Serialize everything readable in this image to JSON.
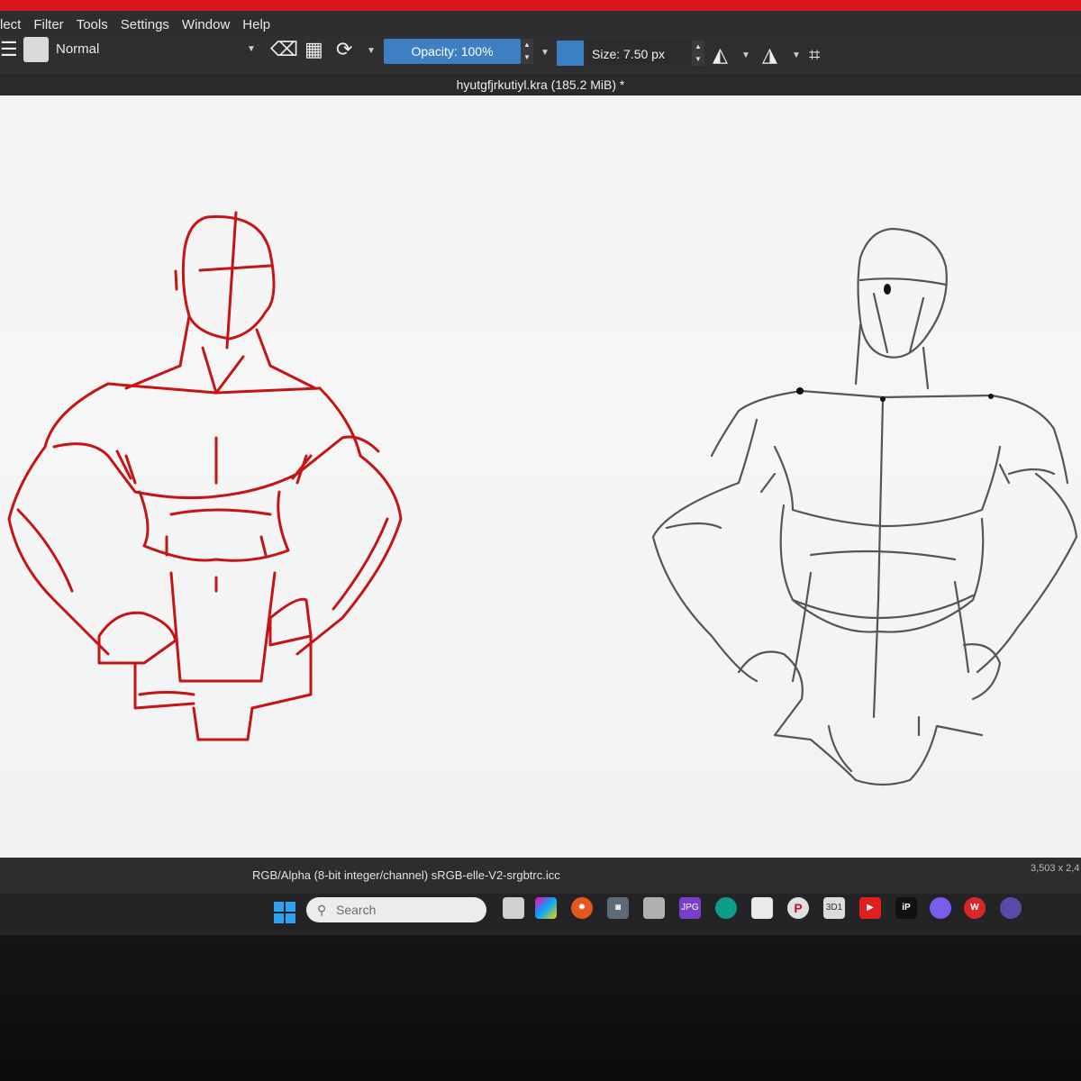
{
  "app": {
    "menu": [
      "lect",
      "Filter",
      "Tools",
      "Settings",
      "Window",
      "Help"
    ],
    "blend_mode": "Normal",
    "opacity_label": "Opacity: 100%",
    "size_label": "Size: 7.50 px",
    "document_title": "hyutgfjrkutiyl.kra (185.2 MiB) *",
    "status": "RGB/Alpha (8-bit integer/channel)  sRGB-elle-V2-srgbtrc.icc",
    "dimensions": "3,503 x 2,4",
    "colors": {
      "accent": "#3d7fc2",
      "red_sketch": "#c41414",
      "gray_sketch": "#3a3a3a"
    }
  },
  "taskbar": {
    "search_placeholder": "Search",
    "icons": [
      "windows-start-icon",
      "search-icon",
      "task-view-icon",
      "copilot-icon",
      "settings-gear-icon",
      "camera-icon",
      "file-explorer-icon",
      "jpg-app-icon",
      "edge-icon",
      "store-icon",
      "pinterest-icon",
      "3d1-app-icon",
      "youtube-icon",
      "ip-app-icon",
      "messenger-icon",
      "wps-icon",
      "krita-icon"
    ],
    "labels": {
      "jpg": "JPG",
      "three_d": "3D1",
      "ip": "iP",
      "wps": "W"
    }
  }
}
